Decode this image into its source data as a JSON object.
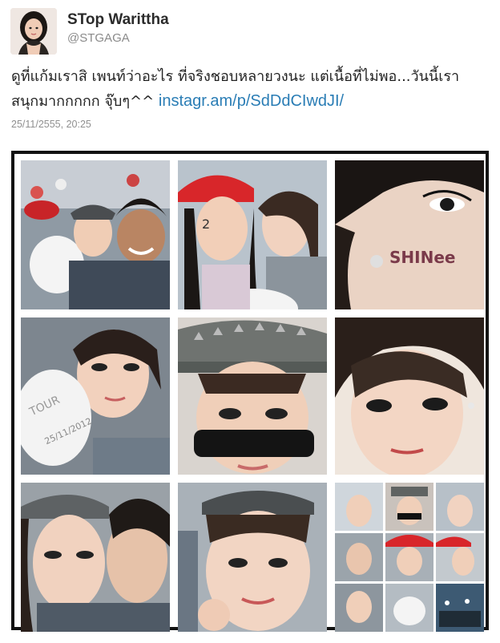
{
  "user": {
    "display_name": "STop Warittha",
    "handle": "@STGAGA"
  },
  "tweet": {
    "text_line1": "ดูที่แก้มเราสิ เพนท์ว่าอะไร ที่จริงชอบหลายวงนะ แต่เนื้อที่ไม่พอ...วันนี้เรา",
    "text_line2": "สนุกมากกกกก จุ๊บๆ^^ ",
    "link": "instagr.am/p/SdDdCIwdJI/",
    "timestamp": "25/11/2555, 20:25"
  },
  "photo": {
    "cheek_text": "SHINee",
    "balloon_text": "TOUR",
    "balloon_date": "25/11/2012"
  },
  "colors": {
    "link": "#2a7db5",
    "frame": "#111111",
    "red_hat": "#d8262a",
    "skin": "#f1cfb8",
    "grey_cap": "#6f7370"
  }
}
